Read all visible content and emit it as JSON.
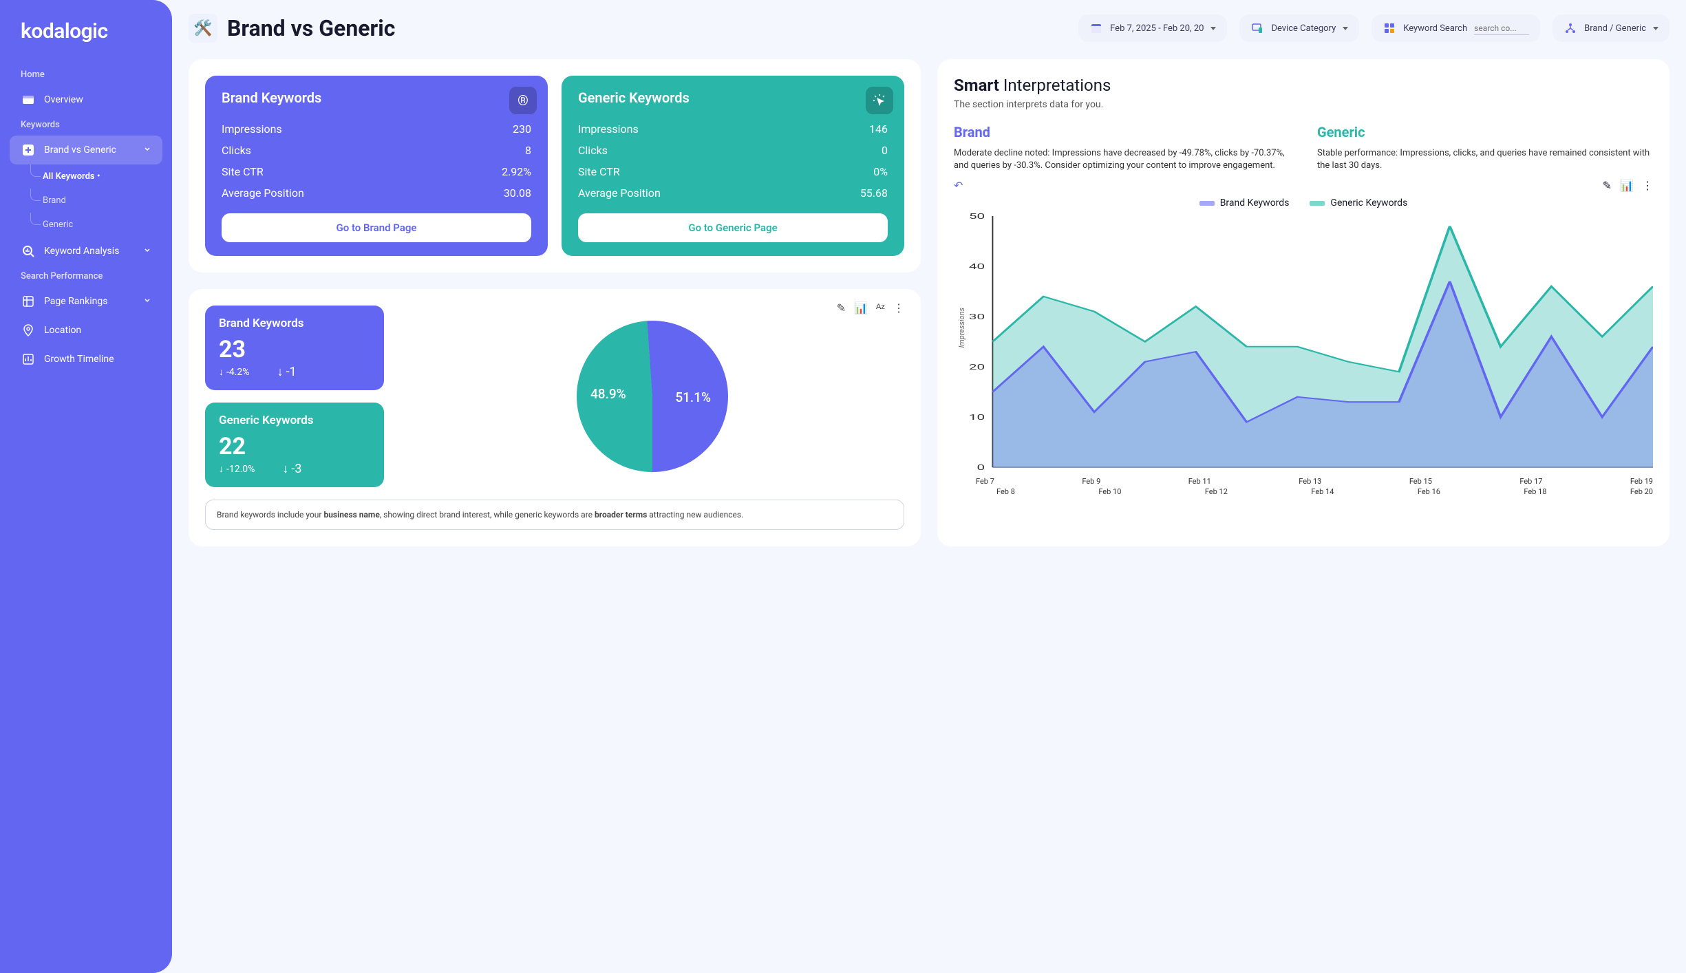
{
  "brand_name": "kodalogic",
  "sidebar": {
    "home_label": "Home",
    "overview": "Overview",
    "keywords_label": "Keywords",
    "brand_vs_generic": "Brand vs Generic",
    "all_keywords": "All Keywords •",
    "brand": "Brand",
    "generic": "Generic",
    "keyword_analysis": "Keyword Analysis",
    "search_perf_label": "Search Performance",
    "page_rankings": "Page Rankings",
    "location": "Location",
    "growth_timeline": "Growth Timeline"
  },
  "header": {
    "title": "Brand vs Generic",
    "date_range": "Feb 7, 2025 - Feb 20, 20",
    "device_label": "Device Category",
    "keyword_search_label": "Keyword Search",
    "keyword_search_placeholder": "search co...",
    "brand_generic_label": "Brand / Generic"
  },
  "brand_card": {
    "title": "Brand Keywords",
    "impressions_label": "Impressions",
    "impressions": "230",
    "clicks_label": "Clicks",
    "clicks": "8",
    "ctr_label": "Site CTR",
    "ctr": "2.92%",
    "pos_label": "Average Position",
    "pos": "30.08",
    "button": "Go to Brand Page"
  },
  "generic_card": {
    "title": "Generic Keywords",
    "impressions_label": "Impressions",
    "impressions": "146",
    "clicks_label": "Clicks",
    "clicks": "0",
    "ctr_label": "Site CTR",
    "ctr": "0%",
    "pos_label": "Average Position",
    "pos": "55.68",
    "button": "Go to Generic Page"
  },
  "smart": {
    "title_bold": "Smart",
    "title_rest": " Interpretations",
    "subtitle": "The section interprets data for you.",
    "brand_title": "Brand",
    "brand_text": "Moderate decline noted: Impressions have decreased by -49.78%, clicks by -70.37%, and queries by -30.3%. Consider optimizing your content to improve engagement.",
    "generic_title": "Generic",
    "generic_text": "Stable performance: Impressions, clicks, and queries have remained consistent with the last 30 days."
  },
  "split": {
    "brand_title": "Brand Keywords",
    "brand_value": "23",
    "brand_pct": "-4.2%",
    "brand_delta": "-1",
    "generic_title": "Generic Keywords",
    "generic_value": "22",
    "generic_pct": "-12.0%",
    "generic_delta": "-3",
    "pie_left": "48.9%",
    "pie_right": "51.1%",
    "info_pt1": "Brand keywords include your ",
    "info_b1": "business name",
    "info_pt2": ", showing direct brand interest, while generic keywords are ",
    "info_b2": "broader terms",
    "info_pt3": " attracting new audiences."
  },
  "chart_legend": {
    "brand": "Brand Keywords",
    "generic": "Generic Keywords"
  },
  "chart_data": {
    "type": "area",
    "ylabel": "Impressions",
    "ylim": [
      0,
      50
    ],
    "yticks": [
      0,
      10,
      20,
      30,
      40,
      50
    ],
    "x": [
      "Feb 7",
      "Feb 8",
      "Feb 9",
      "Feb 10",
      "Feb 11",
      "Feb 12",
      "Feb 13",
      "Feb 14",
      "Feb 15",
      "Feb 16",
      "Feb 17",
      "Feb 18",
      "Feb 19",
      "Feb 20"
    ],
    "series": [
      {
        "name": "Brand Keywords",
        "color": "#6366f1",
        "values": [
          15,
          24,
          11,
          21,
          23,
          9,
          14,
          13,
          13,
          37,
          10,
          26,
          10,
          24
        ]
      },
      {
        "name": "Generic Keywords",
        "color": "#2ab7a9",
        "values": [
          25,
          34,
          31,
          25,
          32,
          24,
          24,
          21,
          19,
          48,
          24,
          36,
          26,
          36
        ]
      }
    ],
    "x_top_labels": [
      "Feb 7",
      "Feb 9",
      "Feb 11",
      "Feb 13",
      "Feb 15",
      "Feb 17",
      "Feb 19"
    ],
    "x_bot_labels": [
      "Feb 8",
      "Feb 10",
      "Feb 12",
      "Feb 14",
      "Feb 16",
      "Feb 18",
      "Feb 20"
    ]
  },
  "colors": {
    "brand": "#6366f1",
    "generic": "#2ab7a9"
  }
}
